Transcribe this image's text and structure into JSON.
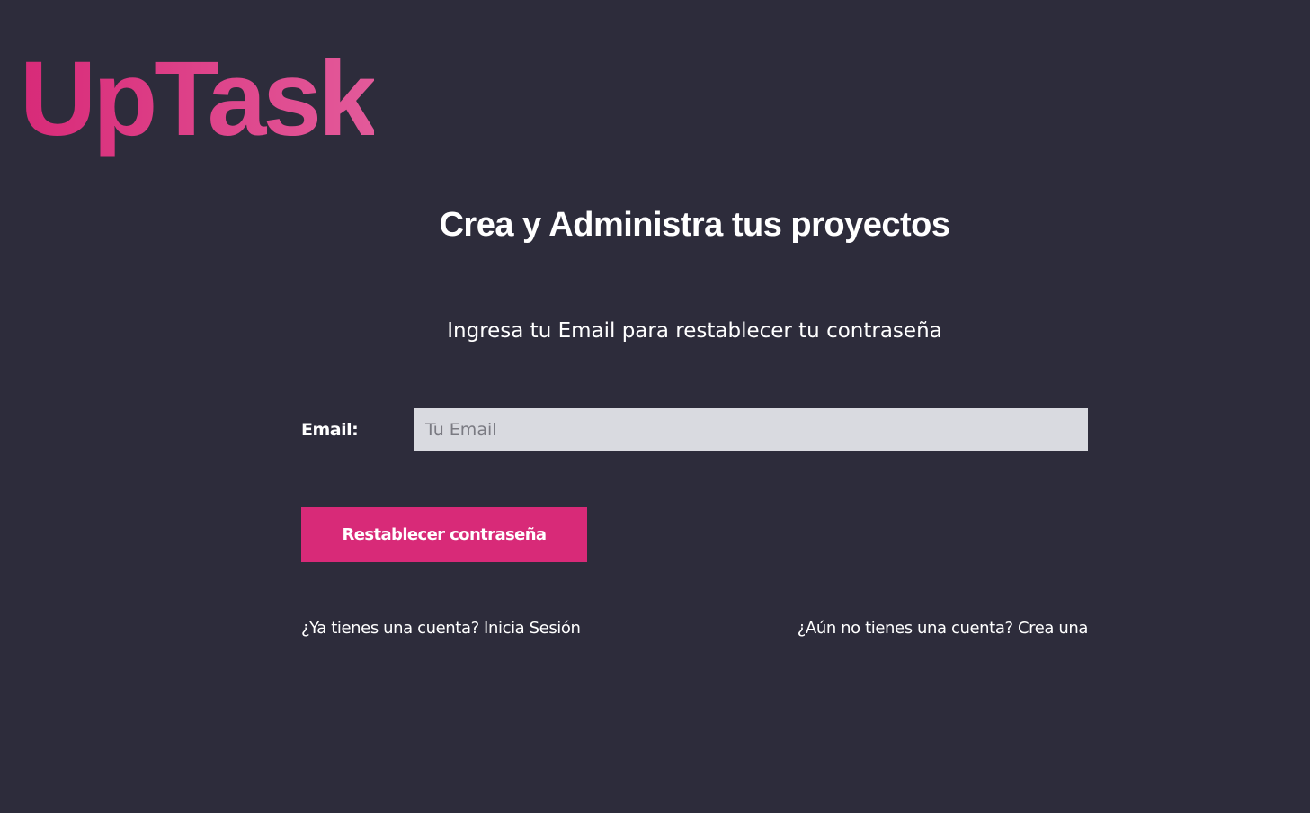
{
  "brand": {
    "logo_text": "UpTask",
    "accent_color": "#d82a78"
  },
  "header": {
    "tagline": "Crea y Administra tus proyectos"
  },
  "main": {
    "description": "Ingresa tu Email para restablecer tu contraseña",
    "form": {
      "email_label": "Email:",
      "email_placeholder": "Tu Email",
      "email_value": "",
      "submit_label": "Restablecer contraseña"
    },
    "links": {
      "login": "¿Ya tienes una cuenta? Inicia Sesión",
      "register": "¿Aún no tienes una cuenta? Crea una"
    }
  },
  "colors": {
    "background": "#2d2c3b",
    "input_background": "#d9dae0",
    "text": "#ffffff"
  }
}
